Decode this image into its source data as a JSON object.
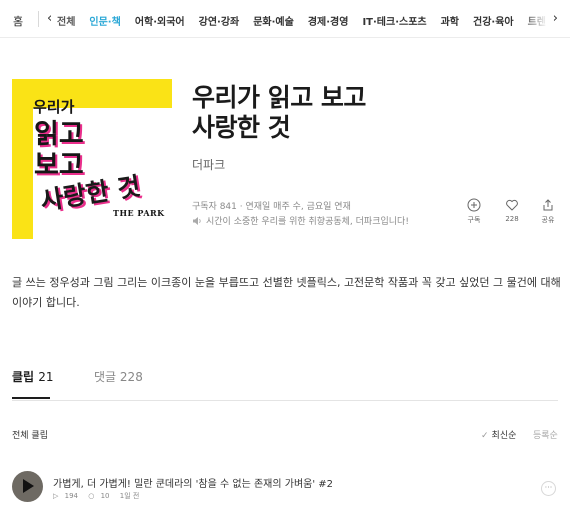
{
  "nav": {
    "home": "홈",
    "categories": [
      "전체",
      "인문·책",
      "어학·외국어",
      "강연·강좌",
      "문화·예술",
      "경제·경영",
      "IT·테크·스포츠",
      "과학",
      "건강·육아",
      "트렌"
    ],
    "active_index": 1
  },
  "cover": {
    "line1": "우리가",
    "line2": "읽고",
    "line3": "보고",
    "line4": "사랑한 것",
    "brand": "THE PARK"
  },
  "channel": {
    "title_line1": "우리가 읽고 보고",
    "title_line2": "사랑한 것",
    "author": "더파크",
    "meta": "구독자 841 · 연재일 매주 수, 금요일 연재",
    "promo": "시간이 소중한 우리를 위한 취향공동체, 더파크입니다!",
    "actions": {
      "subscribe_label": "구독",
      "like_count": "228",
      "share_label": "공유"
    },
    "description": "글 쓰는 정우성과 그림 그리는 이크종이 눈을 부릅뜨고 선별한 넷플릭스, 고전문학 작품과 꼭 갖고 싶었던 그 물건에 대해 이야기 합니다."
  },
  "tabs": {
    "clip_label": "클립",
    "clip_count": "21",
    "comment_label": "댓글",
    "comment_count": "228"
  },
  "list": {
    "section_label": "전체 클립",
    "sort_latest": "최신순",
    "sort_registered": "등록순",
    "items": [
      {
        "title": "가볍게, 더 가볍게! 밀란 쿤데라의 '참을 수 없는 존재의 가벼움' #2",
        "plays": "194",
        "comments": "10",
        "date": "1일 전"
      }
    ]
  },
  "colors": {
    "accent": "#2aa7d6",
    "cover_yellow": "#fae316",
    "cover_pink": "#ea2f8c"
  }
}
